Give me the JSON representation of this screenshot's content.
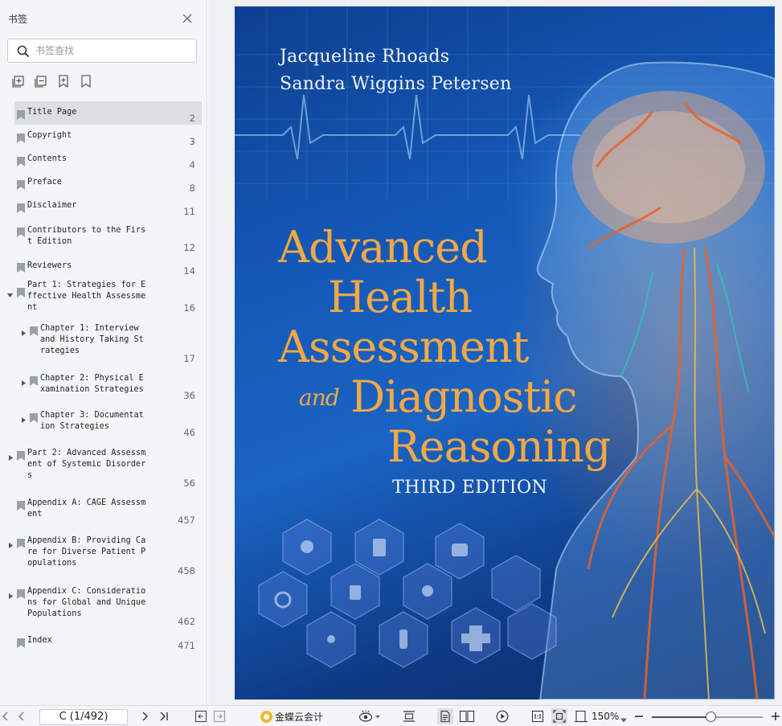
{
  "sidebar": {
    "title": "书签",
    "search_placeholder": "书签查找",
    "bookmarks": [
      {
        "label": "Title Page",
        "page": "2",
        "selected": true,
        "arrow": "none",
        "indent": 0
      },
      {
        "label": "Copyright",
        "page": "3",
        "arrow": "none",
        "indent": 0
      },
      {
        "label": "Contents",
        "page": "4",
        "arrow": "none",
        "indent": 0
      },
      {
        "label": "Preface",
        "page": "8",
        "arrow": "none",
        "indent": 0
      },
      {
        "label": "Disclaimer",
        "page": "11",
        "arrow": "none",
        "indent": 0
      },
      {
        "label": "Contributors to the Firs\nt Edition",
        "page": "12",
        "arrow": "none",
        "indent": 0
      },
      {
        "label": "Reviewers",
        "page": "14",
        "arrow": "none",
        "indent": 0
      },
      {
        "label": "Part 1: Strategies for E\nffective Health Assessme\nnt",
        "page": "16",
        "arrow": "down",
        "indent": 0
      },
      {
        "label": "Chapter 1: Interview\nand History Taking St\nrategies",
        "page": "17",
        "arrow": "right",
        "indent": 1
      },
      {
        "label": "Chapter 2: Physical E\nxamination Strategies",
        "page": "36",
        "arrow": "right",
        "indent": 1
      },
      {
        "label": "Chapter 3: Documentat\nion Strategies",
        "page": "46",
        "arrow": "right",
        "indent": 1
      },
      {
        "label": "Part 2: Advanced Assessm\nent of Systemic Disorder\ns",
        "page": "56",
        "arrow": "right",
        "indent": 0
      },
      {
        "label": "Appendix A: CAGE Assessm\nent",
        "page": "457",
        "arrow": "none",
        "indent": 0
      },
      {
        "label": "Appendix B: Providing Ca\nre for Diverse Patient P\nopulations",
        "page": "458",
        "arrow": "right",
        "indent": 0
      },
      {
        "label": "Appendix C: Consideratio\nns for Global and Unique\nPopulations",
        "page": "462",
        "arrow": "right",
        "indent": 0
      },
      {
        "label": "Index",
        "page": "471",
        "arrow": "none",
        "indent": 0
      }
    ]
  },
  "cover": {
    "author_1": "Jacqueline Rhoads",
    "author_2": "Sandra Wiggins Petersen",
    "title_line_1": "Advanced",
    "title_line_2": "Health",
    "title_line_3": "Assessment",
    "title_and": "and",
    "title_line_4": "Diagnostic",
    "title_line_5": "Reasoning",
    "edition": "THIRD EDITION"
  },
  "statusbar": {
    "page_indicator": "C (1/492)",
    "cloud_label": "金蝶云会计",
    "zoom_label": "150%",
    "zoom_fraction": 0.53
  },
  "colors": {
    "title_orange": "#f2a845",
    "cover_blue": "#1457b5",
    "sidebar_bg": "#f4f5f7",
    "selected_bg": "#dcdfe3"
  }
}
